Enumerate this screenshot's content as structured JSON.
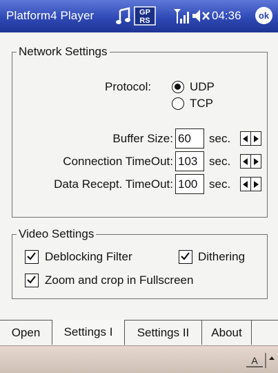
{
  "titlebar": {
    "app_title": "Platform4 Player",
    "time": "04:36",
    "ok_label": "ok",
    "icons": [
      "music-icon",
      "gprs-icon",
      "signal-icon",
      "speaker-muted-icon"
    ],
    "gprs_text_top": "GP",
    "gprs_text_bottom": "RS"
  },
  "network": {
    "title": "Network Settings",
    "protocol_label": "Protocol:",
    "protocol_options": [
      "UDP",
      "TCP"
    ],
    "protocol_selected": "UDP",
    "buffer_size_label": "Buffer Size:",
    "buffer_size_value": "60",
    "connection_timeout_label": "Connection TimeOut:",
    "connection_timeout_value": "103",
    "data_recept_timeout_label": "Data Recept. TimeOut:",
    "data_recept_timeout_value": "100",
    "unit": "sec."
  },
  "video": {
    "title": "Video Settings",
    "deblocking_label": "Deblocking Filter",
    "deblocking_checked": true,
    "dithering_label": "Dithering",
    "dithering_checked": true,
    "zoom_label": "Zoom and crop in Fullscreen",
    "zoom_checked": true
  },
  "tabs": [
    "Open",
    "Settings I",
    "Settings II",
    "About"
  ],
  "active_tab": "Settings I",
  "input_panel": {
    "letter": "A"
  }
}
